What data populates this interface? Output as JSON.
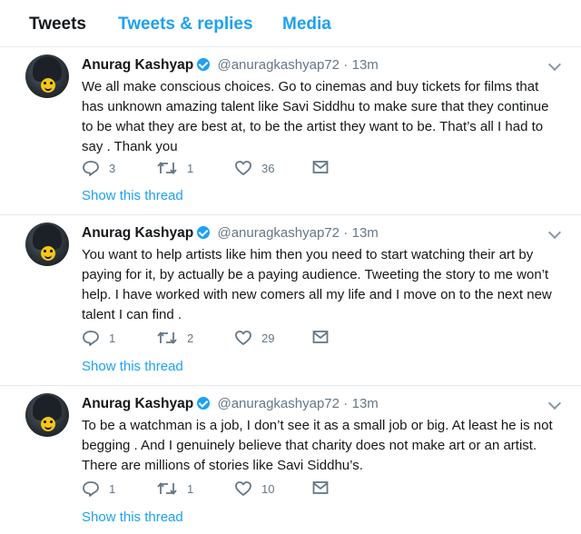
{
  "tabs": [
    {
      "label": "Tweets"
    },
    {
      "label": "Tweets & replies"
    },
    {
      "label": "Media"
    }
  ],
  "colors": {
    "accent": "#1da1f2",
    "text": "#14171a",
    "muted": "#657786"
  },
  "tweets": [
    {
      "name": "Anurag Kashyap",
      "handle": "@anuragkashyap72",
      "separator": "·",
      "time": "13m",
      "text": "We all make conscious choices. Go to cinemas and buy tickets for films that has unknown amazing talent like Savi Siddhu to make sure that they continue to be what they are best at, to be the artist they want to be. That’s all I had to say . Thank you",
      "replies": "3",
      "retweets": "1",
      "likes": "36",
      "thread_link": "Show this thread"
    },
    {
      "name": "Anurag Kashyap",
      "handle": "@anuragkashyap72",
      "separator": "·",
      "time": "13m",
      "text": "You want to help artists like him then you need to start watching their art by paying for it, by actually be a paying audience. Tweeting the story to me won’t help. I have worked with new comers all my life and I move on to the next new talent I can find .",
      "replies": "1",
      "retweets": "2",
      "likes": "29",
      "thread_link": "Show this thread"
    },
    {
      "name": "Anurag Kashyap",
      "handle": "@anuragkashyap72",
      "separator": "·",
      "time": "13m",
      "text": "To be a watchman is a job, I don’t see it as a small job or big. At least he is not begging . And I genuinely believe that charity does not make art or an artist. There are millions of stories like Savi Siddhu’s.",
      "replies": "1",
      "retweets": "1",
      "likes": "10",
      "thread_link": "Show this thread"
    }
  ]
}
